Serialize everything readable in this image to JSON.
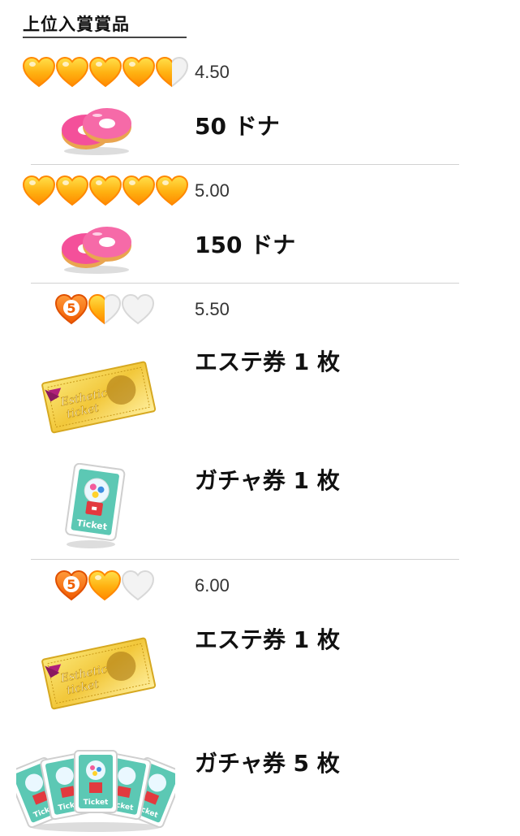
{
  "header": {
    "title": "上位入賞賞品"
  },
  "tiers": [
    {
      "score": "4.50",
      "hearts": [
        "full",
        "full",
        "full",
        "full",
        "half"
      ],
      "prizes": [
        {
          "icon": "donut-icon",
          "label": "50 ドナ"
        }
      ]
    },
    {
      "score": "5.00",
      "hearts": [
        "full",
        "full",
        "full",
        "full",
        "full"
      ],
      "prizes": [
        {
          "icon": "donut-icon",
          "label": "150 ドナ"
        }
      ]
    },
    {
      "score": "5.50",
      "hearts": [
        "five",
        "half",
        "empty"
      ],
      "prizes": [
        {
          "icon": "esthetic-ticket-icon",
          "label": "エステ券 1 枚"
        },
        {
          "icon": "gacha-ticket-icon",
          "label": "ガチャ券 1 枚"
        }
      ]
    },
    {
      "score": "6.00",
      "hearts": [
        "five",
        "full",
        "empty"
      ],
      "prizes": [
        {
          "icon": "esthetic-ticket-icon",
          "label": "エステ券 1 枚"
        },
        {
          "icon": "gacha-tickets-fan-icon",
          "label": "ガチャ券 5 枚"
        }
      ]
    }
  ],
  "badge": {
    "five_text": "5"
  },
  "ticket_text": {
    "esthetic_line1": "Esthetic",
    "esthetic_line2": "ticket",
    "gacha": "Ticket"
  },
  "colors": {
    "heart_orange": "#ff9a00",
    "heart_yellow": "#ffd21c",
    "donut_pink": "#f4509a",
    "ticket_gold": "#f2cc3c",
    "gacha_teal": "#5cc8b4",
    "gacha_red": "#e23a3f"
  }
}
